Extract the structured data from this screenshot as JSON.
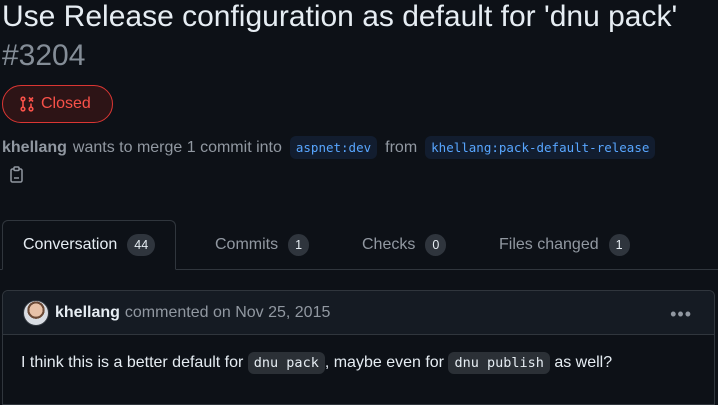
{
  "pr": {
    "title": "Use Release configuration as default for 'dnu pack'",
    "number": "#3204",
    "state": "Closed",
    "author": "khellang",
    "merge_text": "wants to merge 1 commit into",
    "base_branch": "aspnet:dev",
    "from_text": "from",
    "head_branch": "khellang:pack-default-release"
  },
  "tabs": [
    {
      "label": "Conversation",
      "count": "44"
    },
    {
      "label": "Commits",
      "count": "1"
    },
    {
      "label": "Checks",
      "count": "0"
    },
    {
      "label": "Files changed",
      "count": "1"
    }
  ],
  "comment": {
    "author": "khellang",
    "meta": "commented on Nov 25, 2015",
    "menu": "•••",
    "body_before": "I think this is a better default for",
    "code1": "dnu pack",
    "body_middle": ", maybe even for",
    "code2": "dnu publish",
    "body_after": "as well?"
  },
  "colors": {
    "background": "#0d1117",
    "closed": "#f85149",
    "link": "#58a6ff"
  }
}
